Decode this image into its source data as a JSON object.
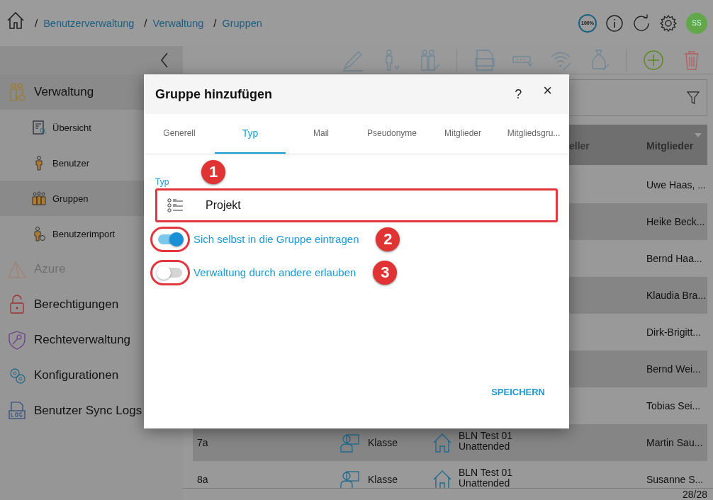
{
  "breadcrumb": [
    {
      "separator": "/",
      "label": "Benutzerverwaltung"
    },
    {
      "separator": "/",
      "label": "Verwaltung"
    },
    {
      "separator": "/",
      "label": "Gruppen"
    }
  ],
  "header": {
    "zoom_badge": "100%",
    "avatar": "SS"
  },
  "sidebar": {
    "items": [
      {
        "label": "Verwaltung",
        "disabled": false,
        "expanded": true,
        "children": [
          {
            "label": "Übersicht",
            "selected": false
          },
          {
            "label": "Benutzer",
            "selected": false
          },
          {
            "label": "Gruppen",
            "selected": true
          },
          {
            "label": "Benutzerimport",
            "selected": false
          }
        ]
      },
      {
        "label": "Azure",
        "disabled": true
      },
      {
        "label": "Berechtigungen",
        "disabled": false
      },
      {
        "label": "Rechteverwaltung",
        "disabled": false
      },
      {
        "label": "Konfigurationen",
        "disabled": false
      },
      {
        "label": "Benutzer Sync Logs",
        "disabled": false
      }
    ]
  },
  "table": {
    "columns": [
      {
        "label": "eller"
      },
      {
        "label": "Mitglieder"
      }
    ],
    "rows": [
      {
        "members": "Uwe Haas, ..."
      },
      {
        "members": "Heike Beck..."
      },
      {
        "members": "Bernd Haa..."
      },
      {
        "members": "Klaudia Bra..."
      },
      {
        "members": "Dirk-Brigitt..."
      },
      {
        "members": "Bernd Wei..."
      },
      {
        "members": "Tobias Sei..."
      },
      {
        "name": "7a",
        "type": "Klasse",
        "location": "BLN Test 01\nUnattended",
        "members": "Martin Sau..."
      },
      {
        "name": "8a",
        "type": "Klasse",
        "location": "BLN Test 01\nUnattended",
        "members": "Susanne S..."
      }
    ],
    "count": "28/28"
  },
  "dialog": {
    "title": "Gruppe hinzufügen",
    "help": "?",
    "close": "×",
    "tabs": [
      {
        "label": "Generell",
        "selected": false
      },
      {
        "label": "Typ",
        "selected": true
      },
      {
        "label": "Mail",
        "selected": false
      },
      {
        "label": "Pseudonyme",
        "selected": false
      },
      {
        "label": "Mitglieder",
        "selected": false
      },
      {
        "label": "Mitgliedsgru...",
        "selected": false
      }
    ],
    "field": {
      "label": "Typ",
      "value": "Projekt",
      "marker": "1"
    },
    "toggles": [
      {
        "label": "Sich selbst in die Gruppe eintragen",
        "on": true,
        "marker": "2"
      },
      {
        "label": "Verwaltung durch andere erlauben",
        "on": false,
        "marker": "3"
      }
    ],
    "save": "SPEICHERN"
  }
}
